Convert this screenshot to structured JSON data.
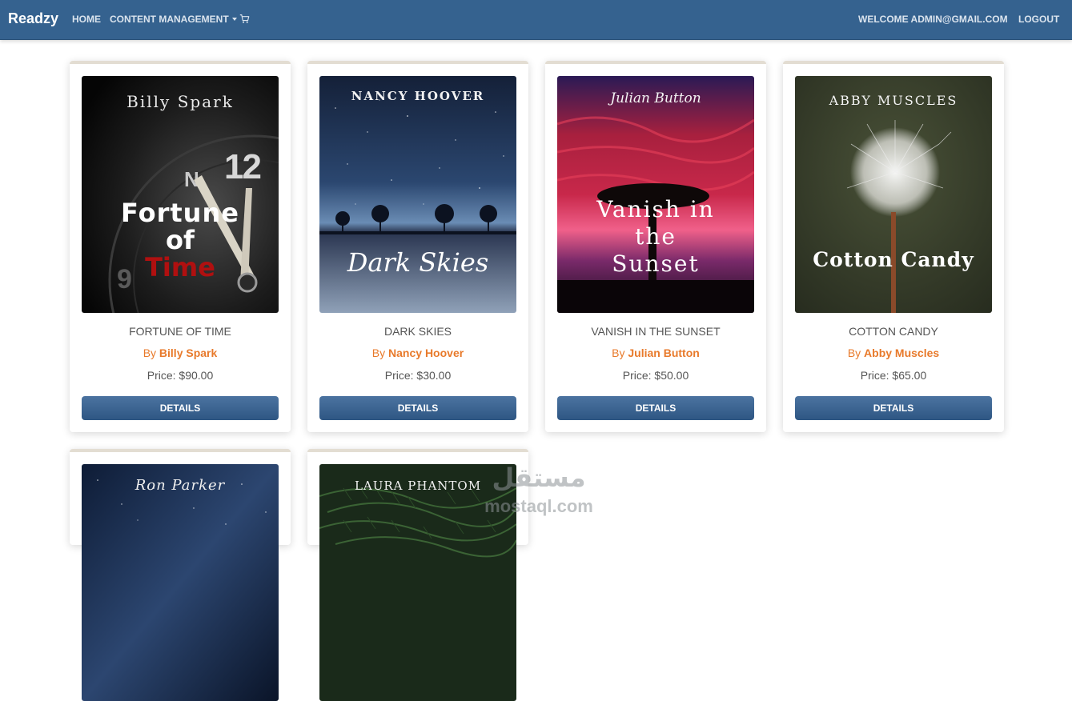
{
  "navbar": {
    "brand": "Readzy",
    "home": "HOME",
    "content_management": "CONTENT MANAGEMENT",
    "cart_icon": "cart-icon",
    "welcome": "WELCOME ADMIN@GMAIL.COM",
    "logout": "LOGOUT",
    "background_color": "#35628f"
  },
  "books": [
    {
      "title": "Fortune of Time",
      "by": "By ",
      "author": "Billy Spark",
      "price": "Price: $90.00",
      "details": "DETAILS",
      "cover": {
        "author_line": "Billy Spark",
        "title_lines": [
          "Fortune",
          "of",
          "Time"
        ]
      }
    },
    {
      "title": "Dark Skies",
      "by": "By ",
      "author": "Nancy Hoover",
      "price": "Price: $30.00",
      "details": "DETAILS",
      "cover": {
        "author_line": "NANCY HOOVER",
        "title_lines": [
          "Dark Skies"
        ]
      }
    },
    {
      "title": "Vanish in the Sunset",
      "by": "By ",
      "author": "Julian Button",
      "price": "Price: $50.00",
      "details": "DETAILS",
      "cover": {
        "author_line": "Julian Button",
        "title_lines": [
          "Vanish in",
          "the",
          "Sunset"
        ]
      }
    },
    {
      "title": "Cotton Candy",
      "by": "By ",
      "author": "Abby Muscles",
      "price": "Price: $65.00",
      "details": "DETAILS",
      "cover": {
        "author_line": "ABBY MUSCLES",
        "title_lines": [
          "Cotton Candy"
        ]
      }
    },
    {
      "cover": {
        "author_line": "Ron Parker"
      }
    },
    {
      "cover": {
        "author_line": "LAURA PHANTOM"
      }
    }
  ],
  "watermark": {
    "arabic": "مستقل",
    "latin": "mostaql.com"
  },
  "colors": {
    "accent": "#e87a2b",
    "button": "#35628f",
    "card_top_border": "#e3ddd2"
  }
}
